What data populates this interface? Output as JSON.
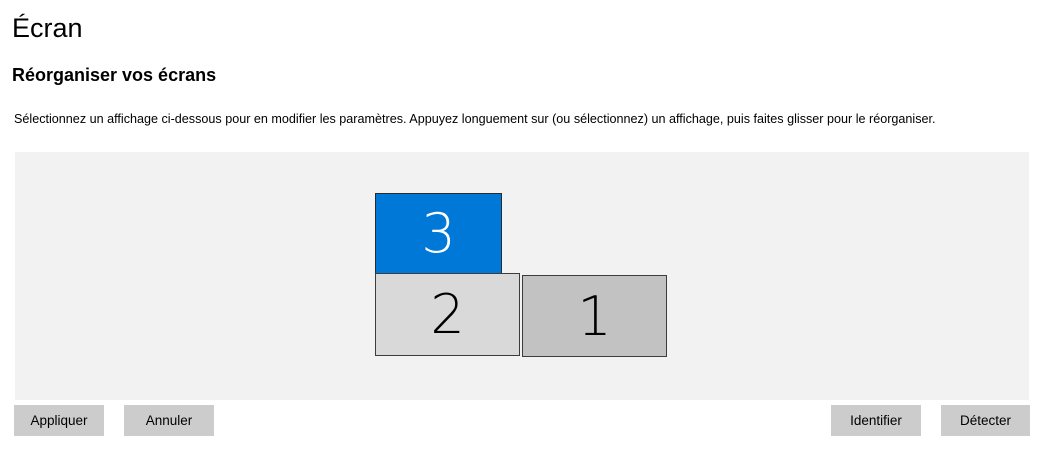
{
  "page": {
    "title": "Écran",
    "section_title": "Réorganiser vos écrans",
    "description": "Sélectionnez un affichage ci-dessous pour en modifier les paramètres. Appuyez longuement sur (ou sélectionnez) un affichage, puis faites glisser pour le réorganiser."
  },
  "displays": [
    {
      "label": "3",
      "selected": true,
      "fill": "#0078d7",
      "text_color": "#ffffff"
    },
    {
      "label": "2",
      "selected": false,
      "fill": "#d9d9d9",
      "text_color": "#000000"
    },
    {
      "label": "1",
      "selected": false,
      "fill": "#c2c2c2",
      "text_color": "#000000"
    }
  ],
  "buttons": {
    "apply": "Appliquer",
    "cancel": "Annuler",
    "identify": "Identifier",
    "detect": "Détecter"
  },
  "colors": {
    "accent": "#0078d7",
    "button_bg": "#cccccc",
    "arrangement_bg": "#f2f2f2"
  }
}
